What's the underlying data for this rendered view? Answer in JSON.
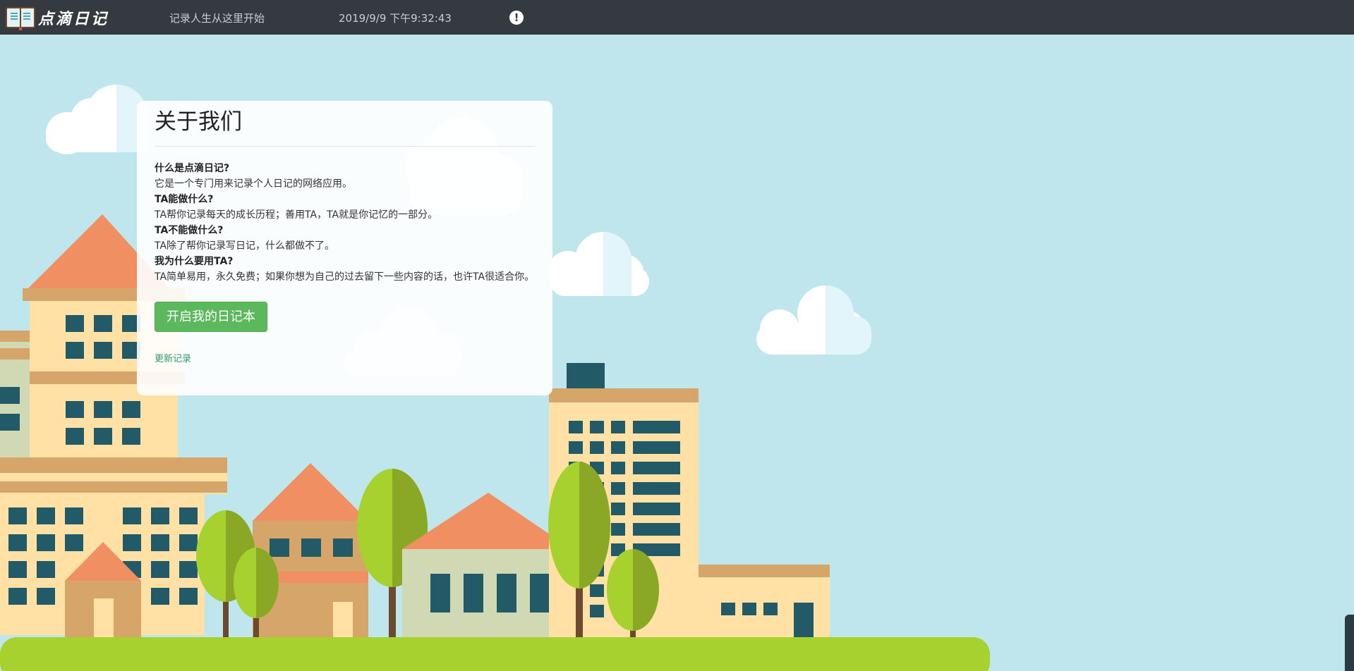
{
  "header": {
    "brand": "点滴日记",
    "slogan": "记录人生从这里开始",
    "datetime": "2019/9/9 下午9:32:43",
    "alert_icon": "!"
  },
  "about": {
    "title": "关于我们",
    "faq": [
      {
        "q": "什么是点滴日记?",
        "a": "它是一个专门用来记录个人日记的网络应用。"
      },
      {
        "q": "TA能做什么?",
        "a": "TA帮你记录每天的成长历程；善用TA，TA就是你记忆的一部分。"
      },
      {
        "q": "TA不能做什么?",
        "a": "TA除了帮你记录写日记，什么都做不了。"
      },
      {
        "q": "我为什么要用TA?",
        "a": "TA简单易用，永久免费；如果你想为自己的过去留下一些内容的话，也许TA很适合你。"
      }
    ],
    "start_button": "开启我的日记本",
    "updates_link": "更新记录"
  },
  "colors": {
    "topbar": "#343a40",
    "sky": "#bee6ec",
    "button": "#5cb85c",
    "grass": "#a6d12e"
  },
  "icons": {
    "brand": "open-book-icon",
    "alert": "exclamation-circle-icon"
  }
}
